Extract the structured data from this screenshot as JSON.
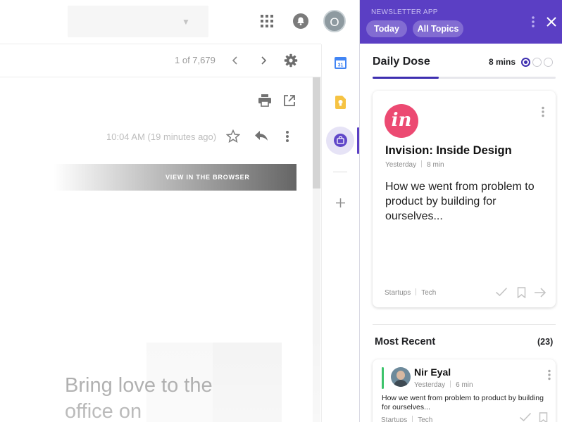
{
  "gmail": {
    "pager": {
      "text": "1 of 7,679"
    },
    "avatar_letter": "O",
    "message": {
      "time": "10:04 AM (19 minutes ago)",
      "view_in_browser": "VIEW IN THE BROWSER",
      "promo_text": "Bring love to the office on"
    },
    "calendar_day": "31"
  },
  "panel": {
    "app_name": "NEWSLETTER APP",
    "chips": [
      {
        "label": "Today"
      },
      {
        "label": "All Topics"
      }
    ],
    "daily_dose": {
      "title": "Daily Dose",
      "mins": "8 mins",
      "progress": 0.36,
      "active_page": 1,
      "page_count": 3
    },
    "featured": {
      "logo_text": "in",
      "title": "Invision: Inside Design",
      "when": "Yesterday",
      "read_time": "8 min",
      "summary": "How we went from problem to product by building for ourselves...",
      "tags": [
        "Startups",
        "Tech"
      ]
    },
    "most_recent": {
      "title": "Most Recent",
      "count": "(23)",
      "items": [
        {
          "name": "Nir Eyal",
          "when": "Yesterday",
          "read_time": "6 min",
          "summary": "How we went from problem to product by building for ourselves...",
          "tags": [
            "Startups",
            "Tech"
          ]
        }
      ]
    }
  },
  "colors": {
    "brand": "#5b3fc4",
    "accent_dark": "#3e2fb0",
    "invision_pink": "#ec4a72",
    "item_accent": "#3cc36b"
  },
  "icons": [
    "apps-icon",
    "bell-icon",
    "chevron-left-icon",
    "chevron-right-icon",
    "gear-icon",
    "print-icon",
    "open-in-new-icon",
    "star-icon",
    "reply-icon",
    "more-vert-icon",
    "calendar-icon",
    "keep-icon",
    "bag-icon",
    "plus-icon",
    "close-icon",
    "check-icon",
    "bookmark-icon",
    "arrow-right-icon"
  ]
}
